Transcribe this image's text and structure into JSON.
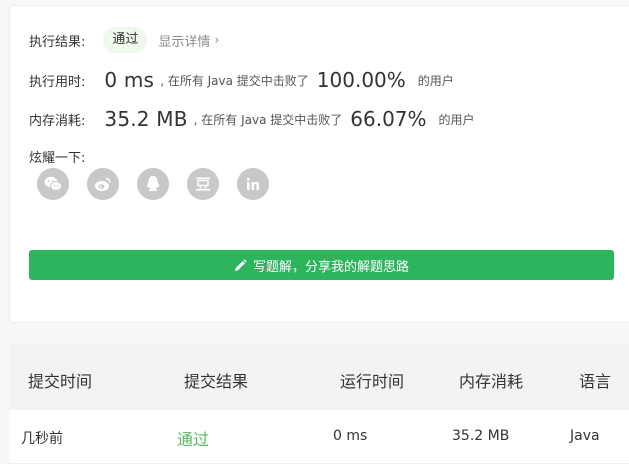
{
  "result": {
    "label": "执行结果:",
    "status": "通过",
    "detail_link": "显示详情"
  },
  "runtime": {
    "label": "执行用时:",
    "value": "0 ms",
    "text_before": ", 在所有 Java 提交中击败了",
    "percent": "100.00%",
    "text_after": "的用户"
  },
  "memory": {
    "label": "内存消耗:",
    "value": "35.2 MB",
    "text_before": ", 在所有 Java 提交中击败了",
    "percent": "66.07%",
    "text_after": "的用户"
  },
  "share": {
    "label": "炫耀一下:",
    "icons": [
      "wechat-icon",
      "weibo-icon",
      "qq-icon",
      "douban-icon",
      "linkedin-icon"
    ]
  },
  "write_button": {
    "label": "写题解，分享我的解题思路"
  },
  "table": {
    "headers": [
      "提交时间",
      "提交结果",
      "运行时间",
      "内存消耗",
      "语言"
    ],
    "rows": [
      {
        "time": "几秒前",
        "result": "通过",
        "runtime": "0 ms",
        "memory": "35.2 MB",
        "language": "Java"
      }
    ]
  },
  "colors": {
    "accent_green": "#2db55d",
    "pass_green": "#5cb85c",
    "badge_bg": "#f0f8eb",
    "icon_gray": "#c8c8c8"
  }
}
